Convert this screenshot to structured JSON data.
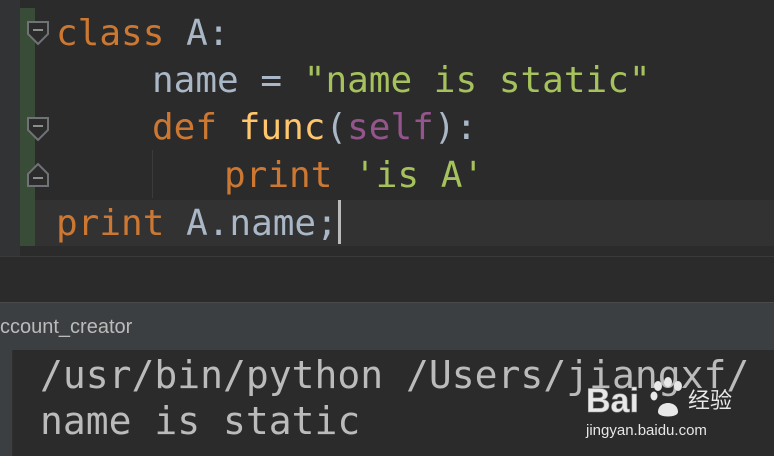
{
  "editor": {
    "lines": [
      {
        "parts": [
          "class",
          "A:"
        ]
      },
      {
        "parts": [
          "name",
          "=",
          "\"name is static\""
        ]
      },
      {
        "parts": [
          "def",
          "func",
          "(",
          "self",
          "):"
        ]
      },
      {
        "parts": [
          "print",
          "'is A'"
        ]
      },
      {
        "parts": [
          "print",
          "A.name;"
        ]
      }
    ]
  },
  "run_panel": {
    "tab_label": "ccount_creator"
  },
  "console": {
    "lines": [
      "/usr/bin/python /Users/jiangxf/",
      "name is static"
    ]
  },
  "watermark": {
    "brand": "Bai",
    "brand_suffix": "经验",
    "url": "jingyan.baidu.com"
  },
  "icons": {
    "fold": "fold-icon",
    "unfold": "unfold-icon"
  },
  "colors": {
    "keyword": "#cc7832",
    "function": "#ffc66d",
    "string": "#a5c25c",
    "self": "#94558d",
    "identifier": "#a9b7c6",
    "background": "#2b2b2b"
  }
}
